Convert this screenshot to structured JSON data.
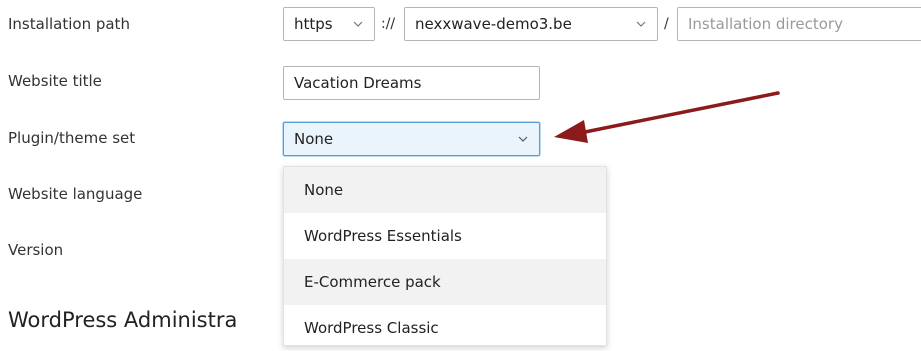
{
  "form": {
    "labels": {
      "installation_path": "Installation path",
      "website_title": "Website title",
      "plugin_theme_set": "Plugin/theme set",
      "website_language": "Website language",
      "version": "Version"
    },
    "protocol": {
      "selected": "https"
    },
    "protocol_separator": "://",
    "domain": {
      "selected": "nexxwave-demo3.be"
    },
    "path_separator": "/",
    "directory": {
      "placeholder": "Installation directory",
      "value": ""
    },
    "website_title_value": "Vacation Dreams",
    "plugin_theme_set": {
      "selected": "None",
      "options": [
        "None",
        "WordPress Essentials",
        "E-Commerce pack",
        "WordPress Classic"
      ]
    }
  },
  "section": {
    "title": "WordPress Administra"
  },
  "annotation": {
    "arrow_color": "#8b1a1a"
  },
  "colors": {
    "focus_border": "#5b9bd5",
    "focus_background": "#eaf4fd",
    "option_highlight": "#f2f2f2"
  }
}
